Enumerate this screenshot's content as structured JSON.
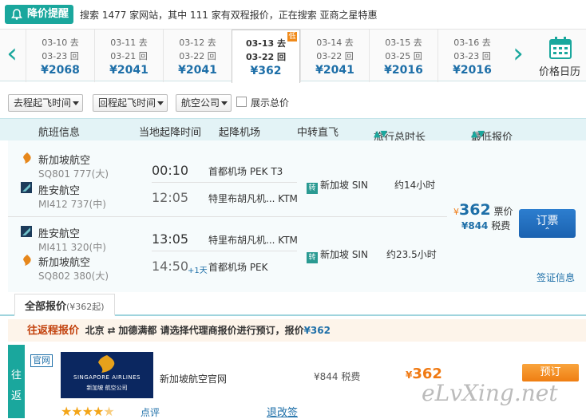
{
  "alert": {
    "button": "降价提醒",
    "text": "搜索 1477 家网站，其中 111 家有双程报价，正在搜索 亚商之星特惠"
  },
  "dates": [
    {
      "out": "03-10 去",
      "back": "03-23 回",
      "price": "¥2068"
    },
    {
      "out": "03-11 去",
      "back": "03-21 回",
      "price": "¥2041"
    },
    {
      "out": "03-12 去",
      "back": "03-22 回",
      "price": "¥2041"
    },
    {
      "out": "03-13 去",
      "back": "03-22 回",
      "price": "¥362",
      "selected": true,
      "badge": "低"
    },
    {
      "out": "03-14 去",
      "back": "03-22 回",
      "price": "¥2041"
    },
    {
      "out": "03-15 去",
      "back": "03-25 回",
      "price": "¥2016"
    },
    {
      "out": "03-16 去",
      "back": "03-23 回",
      "price": "¥2016"
    }
  ],
  "calendar_label": "价格日历",
  "filters": {
    "outbound_time": "去程起飞时间",
    "return_time": "回程起飞时间",
    "airline": "航空公司",
    "show_total": "展示总价"
  },
  "table_header": {
    "flight_info": "航班信息",
    "local_time": "当地起降时间",
    "airports": "起降机场",
    "transfer": "中转直飞",
    "duration": "旅行总时长",
    "lowest_price": "最低报价"
  },
  "outbound": {
    "airline1": "新加坡航空",
    "flight1": "SQ801 777(大)",
    "airline2": "胜安航空",
    "flight2": "MI412 737(中)",
    "dep_time": "00:10",
    "arr_time": "12:05",
    "dep_airport": "首都机场 PEK T3",
    "arr_airport": "特里布胡凡机... KTM",
    "transfer_tag": "转",
    "transfer_city": "新加坡 SIN",
    "duration": "约14小时"
  },
  "inbound": {
    "airline1": "胜安航空",
    "flight1": "MI411 320(中)",
    "airline2": "新加坡航空",
    "flight2": "SQ802 380(大)",
    "dep_time": "13:05",
    "arr_time": "14:50",
    "plus_day": "+1天",
    "dep_airport": "特里布胡凡机... KTM",
    "arr_airport": "首都机场 PEK",
    "transfer_tag": "转",
    "transfer_city": "新加坡 SIN",
    "duration": "约23.5小时"
  },
  "price": {
    "ticket_currency": "¥",
    "ticket": "362",
    "ticket_label": "票价",
    "tax": "¥844",
    "tax_label": "税费",
    "book": "订票",
    "visa": "签证信息"
  },
  "quotes_tab": {
    "label": "全部报价",
    "count": "(¥362起)"
  },
  "roundtrip_bar": {
    "title": "往返程报价",
    "from": "北京",
    "swap_icon": "⇄",
    "to_and_prompt": "加德满都 请选择代理商报价进行预订，报价",
    "price": "¥362"
  },
  "agent": {
    "side_tab": [
      "往",
      "返"
    ],
    "badge": "官网",
    "logo_text_en": "SINGAPORE AIRLINES",
    "logo_text_cn": "新加坡 航空公司",
    "name": "新加坡航空官网",
    "tax": "¥844 税费",
    "price_currency": "¥",
    "price": "362",
    "order": "预订",
    "rating": 4.5,
    "review": "点评",
    "refund": "退改签"
  },
  "watermark": "eLvXing.net",
  "colors": {
    "teal": "#1aa79d",
    "blue": "#1e6fa8",
    "orange": "#f07a13"
  }
}
